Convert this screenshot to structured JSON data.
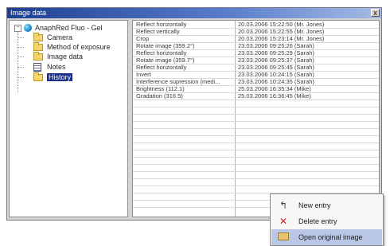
{
  "window": {
    "title": "Image data",
    "close_label": "x"
  },
  "tree": {
    "root_label": "AnaphRed Fluo - Gel",
    "expander_label": "−",
    "nodes": [
      {
        "label": "Camera",
        "icon": "folder-icon"
      },
      {
        "label": "Method of exposure",
        "icon": "folder-icon"
      },
      {
        "label": "Image data",
        "icon": "folder-icon"
      },
      {
        "label": "Notes",
        "icon": "notes-icon"
      },
      {
        "label": "History",
        "icon": "folder-icon",
        "selected": true
      }
    ]
  },
  "history": {
    "rows": [
      {
        "action": "Reflect horizontally",
        "when": "20.03.2006 15:22:50 (Mr. Jones)"
      },
      {
        "action": "Reflect vertically",
        "when": "20.03.2006 15:22:55 (Mr. Jones)"
      },
      {
        "action": "Crop",
        "when": "20.03.2006 15:23:14 (Mr. Jones)"
      },
      {
        "action": "Rotate image (359.2°)",
        "when": "23.03.2006 09:25:26 (Sarah)"
      },
      {
        "action": "Reflect horizontally",
        "when": "23.03.2006 09:25:29 (Sarah)"
      },
      {
        "action": "Rotate image (359.7°)",
        "when": "23.03.2006 09:25:37 (Sarah)"
      },
      {
        "action": "Reflect horizontally",
        "when": "23.03.2006 09:25:45 (Sarah)"
      },
      {
        "action": "Invert",
        "when": "23.03.2006 10:24:15 (Sarah)"
      },
      {
        "action": "Interference supression (medi...",
        "when": "23.03.2006 10:24:35 (Sarah)"
      },
      {
        "action": "Brightness (112.1)",
        "when": "25.03.2006 16:35:34 (Mike)"
      },
      {
        "action": "Gradation (316.5)",
        "when": "25.03.2006 16:36:45 (Mike)"
      }
    ],
    "empty_row_count": 15
  },
  "context_menu": {
    "items": [
      {
        "label": "New entry",
        "icon": "new-entry-icon",
        "glyph": "↰"
      },
      {
        "label": "Delete entry",
        "icon": "delete-icon",
        "glyph": "✕"
      },
      {
        "label": "Open original image",
        "icon": "open-folder-icon",
        "glyph": "",
        "highlighted": true
      }
    ]
  },
  "colors": {
    "titlebar": "#1c3f94",
    "selection": "#1c2f8e",
    "menu_highlight": "#b9c6e6",
    "delete_icon": "#d2261c"
  }
}
